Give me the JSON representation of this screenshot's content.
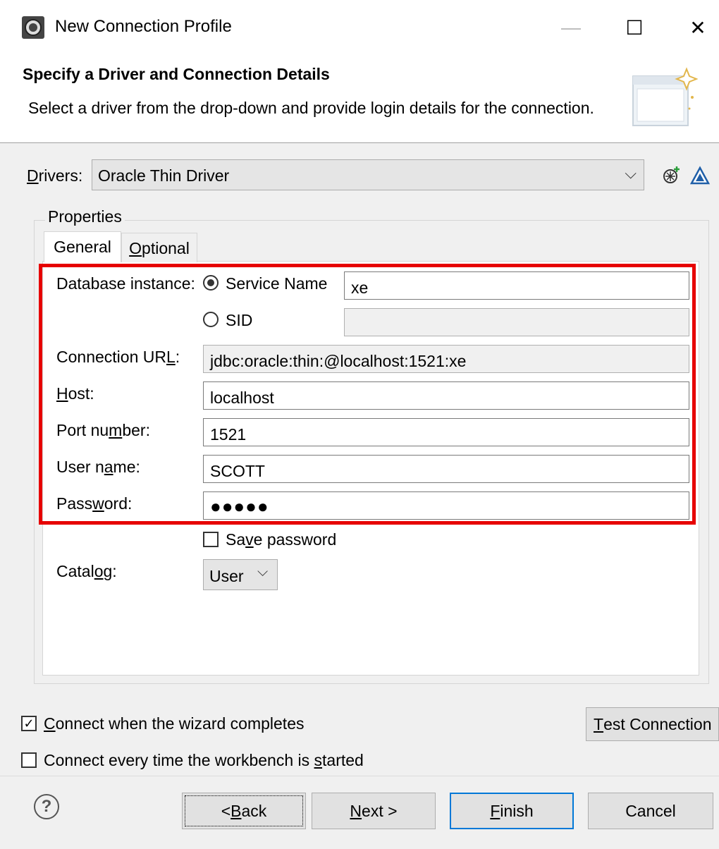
{
  "window": {
    "title": "New Connection Profile",
    "minimize_glyph": "—",
    "maximize_glyph": "☐",
    "close_glyph": "✕",
    "app_icon": "eclipse-icon"
  },
  "header": {
    "title": "Specify a Driver and Connection Details",
    "description": "Select a driver from the drop-down and provide login details for the connection.",
    "banner_icon": "wizard-banner-icon"
  },
  "drivers": {
    "label_first": "D",
    "label_rest": "rivers:",
    "selected": "Oracle Thin Driver",
    "new_driver_icon": "new-driver-icon",
    "edit_driver_icon": "edit-driver-icon"
  },
  "properties": {
    "group_label": "Properties",
    "tabs": [
      {
        "label": "General",
        "active": true
      },
      {
        "label_first": "O",
        "label_rest": "ptional",
        "active": false
      }
    ],
    "database_instance_label": "Database instance:",
    "service_name_label": "Service Name",
    "service_name_value": "xe",
    "sid_label": "SID",
    "sid_value": "",
    "connection_url_label_a": "Connection UR",
    "connection_url_label_b": "L",
    "connection_url_label_c": ":",
    "connection_url_value": "jdbc:oracle:thin:@localhost:1521:xe",
    "host_label_a": "H",
    "host_label_b": "ost:",
    "host_value": "localhost",
    "port_label_a": "Port nu",
    "port_label_b": "m",
    "port_label_c": "ber:",
    "port_value": "1521",
    "user_label_a": "User n",
    "user_label_b": "a",
    "user_label_c": "me:",
    "user_value": "SCOTT",
    "password_label_a": "Pass",
    "password_label_b": "w",
    "password_label_c": "ord:",
    "password_value": "●●●●●",
    "save_password_a": "Sa",
    "save_password_b": "v",
    "save_password_c": "e password",
    "save_password_checked": false,
    "catalog_label_a": "Catal",
    "catalog_label_b": "o",
    "catalog_label_c": "g:",
    "catalog_value": "User"
  },
  "options": {
    "connect_on_complete_a": "C",
    "connect_on_complete_b": "onnect when the wizard completes",
    "connect_on_complete_checked": true,
    "connect_every_time_a": "Connect every time the workbench is ",
    "connect_every_time_b": "s",
    "connect_every_time_c": "tarted",
    "connect_every_time_checked": false,
    "test_connection_a": "T",
    "test_connection_b": "est Connection"
  },
  "footer": {
    "help_glyph": "?",
    "back_a": "< ",
    "back_b": "B",
    "back_c": "ack",
    "next_a": "N",
    "next_b": "ext >",
    "finish_a": "F",
    "finish_b": "inish",
    "cancel": "Cancel"
  },
  "colors": {
    "highlight_box": "#e60000",
    "default_button_border": "#0078d7"
  }
}
